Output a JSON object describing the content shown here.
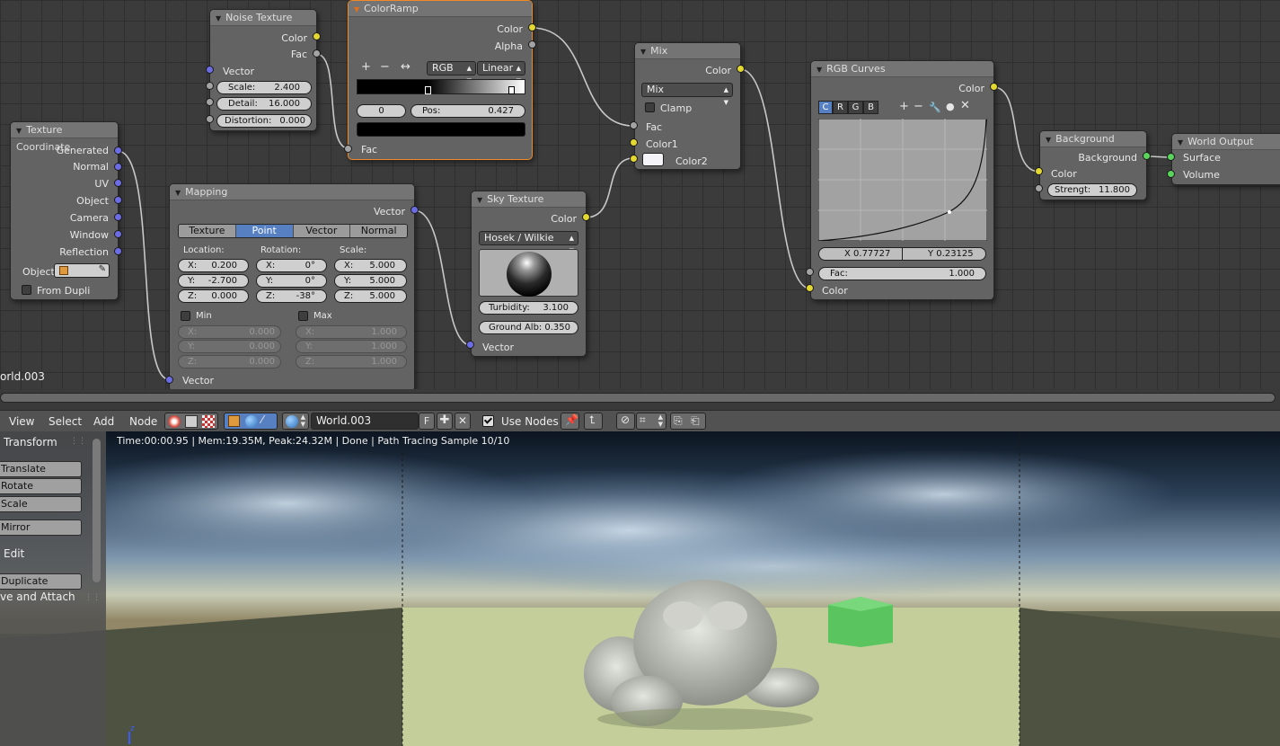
{
  "nodes": {
    "noise_texture": {
      "title": "Noise Texture",
      "out_color": "Color",
      "out_fac": "Fac",
      "in_vector": "Vector",
      "scale_label": "Scale:",
      "scale": "2.400",
      "detail_label": "Detail:",
      "detail": "16.000",
      "distortion_label": "Distortion:",
      "distortion": "0.000"
    },
    "color_ramp": {
      "title": "ColorRamp",
      "out_color": "Color",
      "out_alpha": "Alpha",
      "add": "+",
      "remove": "−",
      "flip": "↔",
      "mode": "RGB",
      "interpolation": "Linear",
      "stop_index": "0",
      "pos_label": "Pos:",
      "pos": "0.427",
      "in_fac": "Fac"
    },
    "mix": {
      "title": "Mix",
      "out_color": "Color",
      "blend": "Mix",
      "clamp": "Clamp",
      "in_fac": "Fac",
      "in_color1": "Color1",
      "in_color2": "Color2"
    },
    "rgb_curves": {
      "title": "RGB Curves",
      "out_color": "Color",
      "channels": [
        "C",
        "R",
        "G",
        "B"
      ],
      "active_channel": "C",
      "x_readout": "X 0.77727",
      "y_readout": "Y 0.23125",
      "fac_label": "Fac:",
      "fac": "1.000",
      "in_color": "Color"
    },
    "background": {
      "title": "Background",
      "out_background": "Background",
      "in_color": "Color",
      "strength_label": "Strengt:",
      "strength": "11.800"
    },
    "world_output": {
      "title": "World Output",
      "in_surface": "Surface",
      "in_volume": "Volume"
    },
    "texture_coordinate": {
      "title": "Texture Coordinate",
      "outputs": [
        "Generated",
        "Normal",
        "UV",
        "Object",
        "Camera",
        "Window",
        "Reflection"
      ],
      "object_label": "Object",
      "from_dupli": "From Dupli"
    },
    "mapping": {
      "title": "Mapping",
      "out_vector": "Vector",
      "tabs": [
        "Texture",
        "Point",
        "Vector",
        "Normal"
      ],
      "active_tab": "Point",
      "location_label": "Location:",
      "rotation_label": "Rotation:",
      "scale_label": "Scale:",
      "location": [
        [
          "X:",
          "0.200"
        ],
        [
          "Y:",
          "-2.700"
        ],
        [
          "Z:",
          "0.000"
        ]
      ],
      "rotation": [
        [
          "X:",
          "0°"
        ],
        [
          "Y:",
          "0°"
        ],
        [
          "Z:",
          "-38°"
        ]
      ],
      "scale": [
        [
          "X:",
          "5.000"
        ],
        [
          "Y:",
          "5.000"
        ],
        [
          "Z:",
          "5.000"
        ]
      ],
      "min_label": "Min",
      "max_label": "Max",
      "min": [
        [
          "X:",
          "0.000"
        ],
        [
          "Y:",
          "0.000"
        ],
        [
          "Z:",
          "0.000"
        ]
      ],
      "max": [
        [
          "X:",
          "1.000"
        ],
        [
          "Y:",
          "1.000"
        ],
        [
          "Z:",
          "1.000"
        ]
      ],
      "in_vector": "Vector"
    },
    "sky_texture": {
      "title": "Sky Texture",
      "out_color": "Color",
      "model": "Hosek / Wilkie",
      "turbidity_label": "Turbidity:",
      "turbidity": "3.100",
      "ground_label": "Ground Alb:",
      "ground": "0.350",
      "in_vector": "Vector"
    }
  },
  "editor_label": "orld.003",
  "header": {
    "view": "View",
    "select": "Select",
    "add": "Add",
    "node": "Node",
    "world_name": "World.003",
    "fake_user": "F",
    "use_nodes": "Use Nodes"
  },
  "toolshelf": {
    "transform": "Transform",
    "translate": "Translate",
    "rotate": "Rotate",
    "scale": "Scale",
    "mirror": "Mirror",
    "edit": "Edit",
    "duplicate": "Duplicate",
    "move_attach": "ve and Attach"
  },
  "render_status": "Time:00:00.95 | Mem:19.35M, Peak:24.32M | Done | Path Tracing Sample 10/10",
  "axis_label": "z",
  "colors": {
    "accent_selected": "#f08a24",
    "socket_color": "#e3d832",
    "socket_float": "#a3a3a3",
    "socket_vector": "#6c6ce4",
    "socket_shader": "#5ad45a",
    "active_blue": "#5680c2"
  }
}
